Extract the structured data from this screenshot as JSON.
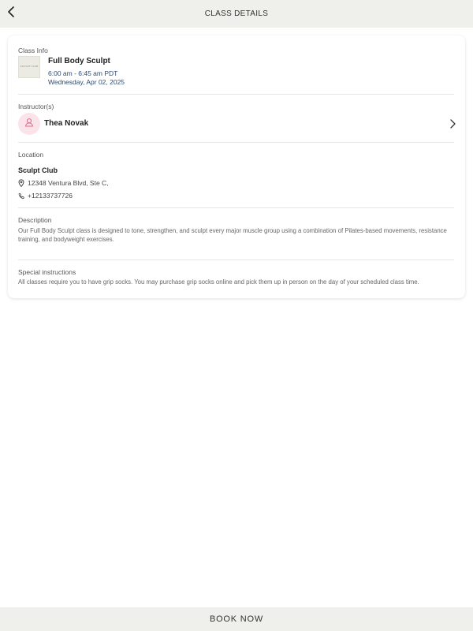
{
  "header": {
    "title": "CLASS DETAILS",
    "back_icon": "chevron-left-icon"
  },
  "class_info": {
    "section_label": "Class Info",
    "thumbnail_text": "SCULPT CLUB",
    "name": "Full Body Sculpt",
    "time": "6:00 am - 6:45 am PDT",
    "date": "Wednesday, Apr 02, 2025"
  },
  "instructor": {
    "section_label": "Instructor(s)",
    "name": "Thea Novak",
    "avatar_icon": "user-icon",
    "chevron_icon": "chevron-right-icon",
    "avatar_color": "#fbe3ea"
  },
  "location": {
    "section_label": "Location",
    "name": "Sculpt Club",
    "address": "12348 Ventura Blvd, Ste C,",
    "phone": "+12133737726",
    "address_icon": "map-pin-icon",
    "phone_icon": "phone-icon"
  },
  "description": {
    "section_label": "Description",
    "text": "Our Full Body Sculpt class is designed to tone, strengthen, and sculpt every major muscle group using a combination of Pilates-based movements, resistance training, and bodyweight exercises."
  },
  "special_instructions": {
    "section_label": "Special instructions",
    "text": "All classes require you to have grip socks. You may purchase grip socks online and pick them up in person on the day of your scheduled class time."
  },
  "footer": {
    "button_label": "BOOK NOW"
  },
  "colors": {
    "bar_background": "#efefeb",
    "accent_text": "#2f4b6e",
    "avatar_pink": "#fbe3ea",
    "avatar_icon": "#d9708f"
  }
}
